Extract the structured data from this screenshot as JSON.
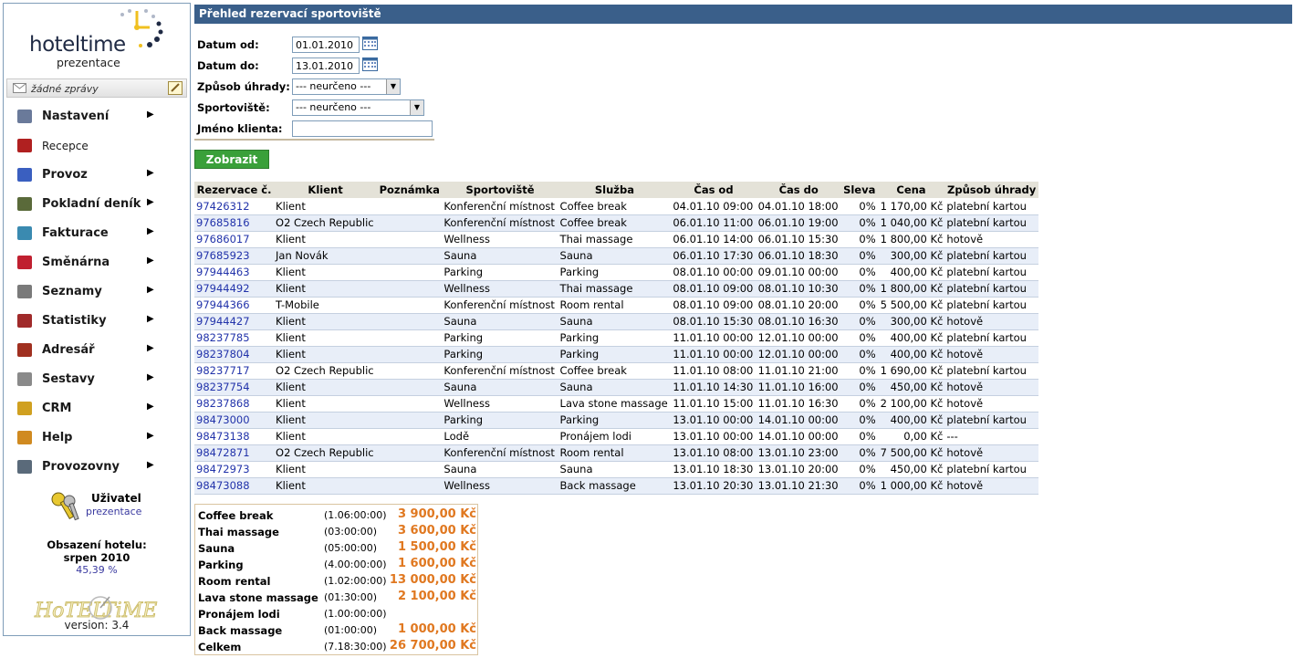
{
  "sidebar": {
    "logo_word": "hoteltime",
    "logo_sub": "prezentace",
    "messages": "žádné zprávy",
    "menu": [
      {
        "label": "Nastavení",
        "icon": "settings-icon",
        "arrow": true,
        "color": "#6a7a9a"
      },
      {
        "label": "Recepce",
        "icon": "reception-icon",
        "arrow": false,
        "color": "#b02020"
      },
      {
        "label": "Provoz",
        "icon": "operation-icon",
        "arrow": true,
        "color": "#3a5fc0"
      },
      {
        "label": "Pokladní deník",
        "icon": "cash-book-icon",
        "arrow": true,
        "color": "#5a6a3a"
      },
      {
        "label": "Fakturace",
        "icon": "invoicing-icon",
        "arrow": true,
        "color": "#3a8ab0"
      },
      {
        "label": "Směnárna",
        "icon": "exchange-icon",
        "arrow": true,
        "color": "#c02030"
      },
      {
        "label": "Seznamy",
        "icon": "lists-icon",
        "arrow": true,
        "color": "#7a7a7a"
      },
      {
        "label": "Statistiky",
        "icon": "statistics-icon",
        "arrow": true,
        "color": "#a02a2a"
      },
      {
        "label": "Adresář",
        "icon": "address-book-icon",
        "arrow": true,
        "color": "#a03020"
      },
      {
        "label": "Sestavy",
        "icon": "reports-icon",
        "arrow": true,
        "color": "#8a8a8a"
      },
      {
        "label": "CRM",
        "icon": "crm-icon",
        "arrow": true,
        "color": "#d0a020"
      },
      {
        "label": "Help",
        "icon": "help-icon",
        "arrow": true,
        "color": "#d08a20"
      },
      {
        "label": "Provozovny",
        "icon": "establishments-icon",
        "arrow": true,
        "color": "#5a6a7a"
      }
    ],
    "user_label": "Uživatel",
    "user_name": "prezentace",
    "occupancy_label": "Obsazení hotelu:",
    "occupancy_period": "srpen 2010",
    "occupancy_value": "45,39 %",
    "version": "version: 3.4"
  },
  "page_title": "Přehled rezervací sportoviště",
  "form": {
    "date_from_label": "Datum od:",
    "date_from_value": "01.01.2010",
    "date_to_label": "Datum do:",
    "date_to_value": "13.01.2010",
    "payment_label": "Způsob úhrady:",
    "payment_value": "--- neurčeno ---",
    "sport_label": "Sportoviště:",
    "sport_value": "--- neurčeno ---",
    "client_label": "Jméno klienta:",
    "client_value": "",
    "submit_label": "Zobrazit"
  },
  "table": {
    "headers": [
      "Rezervace č.",
      "Klient",
      "Poznámka",
      "Sportoviště",
      "Služba",
      "Čas od",
      "Čas do",
      "Sleva",
      "Cena",
      "Způsob úhrady"
    ],
    "rows": [
      [
        "97426312",
        "Klient",
        "",
        "Konferenční místnost",
        "Coffee break",
        "04.01.10 09:00",
        "04.01.10 18:00",
        "0%",
        "1 170,00 Kč",
        "platební kartou"
      ],
      [
        "97685816",
        "O2 Czech Republic",
        "",
        "Konferenční místnost",
        "Coffee break",
        "06.01.10 11:00",
        "06.01.10 19:00",
        "0%",
        "1 040,00 Kč",
        "platební kartou"
      ],
      [
        "97686017",
        "Klient",
        "",
        "Wellness",
        "Thai massage",
        "06.01.10 14:00",
        "06.01.10 15:30",
        "0%",
        "1 800,00 Kč",
        "hotově"
      ],
      [
        "97685923",
        "Jan Novák",
        "",
        "Sauna",
        "Sauna",
        "06.01.10 17:30",
        "06.01.10 18:30",
        "0%",
        "300,00 Kč",
        "platební kartou"
      ],
      [
        "97944463",
        "Klient",
        "",
        "Parking",
        "Parking",
        "08.01.10 00:00",
        "09.01.10 00:00",
        "0%",
        "400,00 Kč",
        "platební kartou"
      ],
      [
        "97944492",
        "Klient",
        "",
        "Wellness",
        "Thai massage",
        "08.01.10 09:00",
        "08.01.10 10:30",
        "0%",
        "1 800,00 Kč",
        "platební kartou"
      ],
      [
        "97944366",
        "T-Mobile",
        "",
        "Konferenční místnost",
        "Room rental",
        "08.01.10 09:00",
        "08.01.10 20:00",
        "0%",
        "5 500,00 Kč",
        "platební kartou"
      ],
      [
        "97944427",
        "Klient",
        "",
        "Sauna",
        "Sauna",
        "08.01.10 15:30",
        "08.01.10 16:30",
        "0%",
        "300,00 Kč",
        "hotově"
      ],
      [
        "98237785",
        "Klient",
        "",
        "Parking",
        "Parking",
        "11.01.10 00:00",
        "12.01.10 00:00",
        "0%",
        "400,00 Kč",
        "platební kartou"
      ],
      [
        "98237804",
        "Klient",
        "",
        "Parking",
        "Parking",
        "11.01.10 00:00",
        "12.01.10 00:00",
        "0%",
        "400,00 Kč",
        "hotově"
      ],
      [
        "98237717",
        "O2 Czech Republic",
        "",
        "Konferenční místnost",
        "Coffee break",
        "11.01.10 08:00",
        "11.01.10 21:00",
        "0%",
        "1 690,00 Kč",
        "platební kartou"
      ],
      [
        "98237754",
        "Klient",
        "",
        "Sauna",
        "Sauna",
        "11.01.10 14:30",
        "11.01.10 16:00",
        "0%",
        "450,00 Kč",
        "hotově"
      ],
      [
        "98237868",
        "Klient",
        "",
        "Wellness",
        "Lava stone massage",
        "11.01.10 15:00",
        "11.01.10 16:30",
        "0%",
        "2 100,00 Kč",
        "hotově"
      ],
      [
        "98473000",
        "Klient",
        "",
        "Parking",
        "Parking",
        "13.01.10 00:00",
        "14.01.10 00:00",
        "0%",
        "400,00 Kč",
        "platební kartou"
      ],
      [
        "98473138",
        "Klient",
        "",
        "Lodě",
        "Pronájem lodi",
        "13.01.10 00:00",
        "14.01.10 00:00",
        "0%",
        "0,00 Kč",
        "---"
      ],
      [
        "98472871",
        "O2 Czech Republic",
        "",
        "Konferenční místnost",
        "Room rental",
        "13.01.10 08:00",
        "13.01.10 23:00",
        "0%",
        "7 500,00 Kč",
        "hotově"
      ],
      [
        "98472973",
        "Klient",
        "",
        "Sauna",
        "Sauna",
        "13.01.10 18:30",
        "13.01.10 20:00",
        "0%",
        "450,00 Kč",
        "platební kartou"
      ],
      [
        "98473088",
        "Klient",
        "",
        "Wellness",
        "Back massage",
        "13.01.10 20:30",
        "13.01.10 21:30",
        "0%",
        "1 000,00 Kč",
        "hotově"
      ]
    ]
  },
  "summary": [
    {
      "name": "Coffee break",
      "duration": "(1.06:00:00)",
      "price": "3 900,00 Kč"
    },
    {
      "name": "Thai massage",
      "duration": "(03:00:00)",
      "price": "3 600,00 Kč"
    },
    {
      "name": "Sauna",
      "duration": "(05:00:00)",
      "price": "1 500,00 Kč"
    },
    {
      "name": "Parking",
      "duration": "(4.00:00:00)",
      "price": "1 600,00 Kč"
    },
    {
      "name": "Room rental",
      "duration": "(1.02:00:00)",
      "price": "13 000,00 Kč"
    },
    {
      "name": "Lava stone massage",
      "duration": "(01:30:00)",
      "price": "2 100,00 Kč"
    },
    {
      "name": "Pronájem lodi",
      "duration": "(1.00:00:00)",
      "price": ""
    },
    {
      "name": "Back massage",
      "duration": "(01:00:00)",
      "price": "1 000,00 Kč"
    },
    {
      "name": "Celkem",
      "duration": "(7.18:30:00)",
      "price": "26 700,00 Kč"
    }
  ]
}
